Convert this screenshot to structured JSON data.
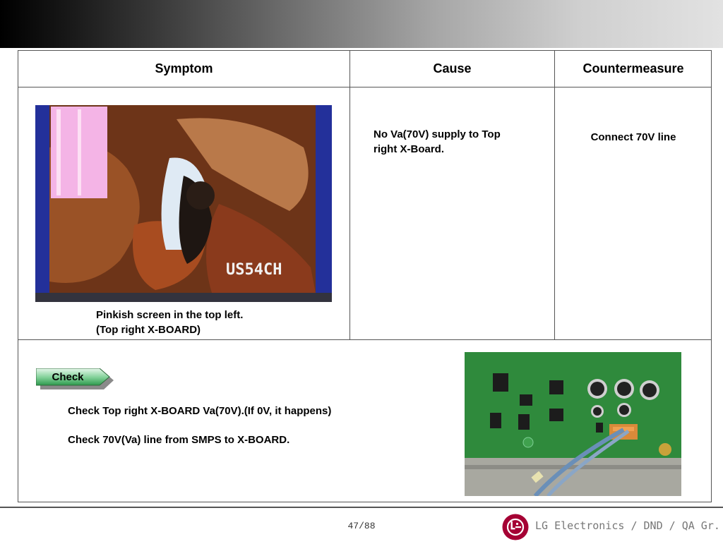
{
  "table": {
    "headers": [
      "Symptom",
      "Cause",
      "Countermeasure"
    ],
    "symptom": {
      "photo_label": "US54CH",
      "caption_line1": "Pinkish screen in the top left.",
      "caption_line2": "(Top right X-BOARD)"
    },
    "cause_line1": "No Va(70V) supply to Top",
    "cause_line2": "right X-Board.",
    "countermeasure": "Connect 70V line",
    "check": {
      "label": "Check",
      "step1": "Check Top right X-BOARD Va(70V).(If 0V, it happens)",
      "step2": "Check 70V(Va) line from SMPS to X-BOARD."
    }
  },
  "footer": {
    "page": "47/88",
    "company": "LG Electronics / DND / QA Gr."
  },
  "colors": {
    "logo": "#a50034",
    "check_tag": "#2e9a4e",
    "board_green": "#2f8a3c"
  }
}
